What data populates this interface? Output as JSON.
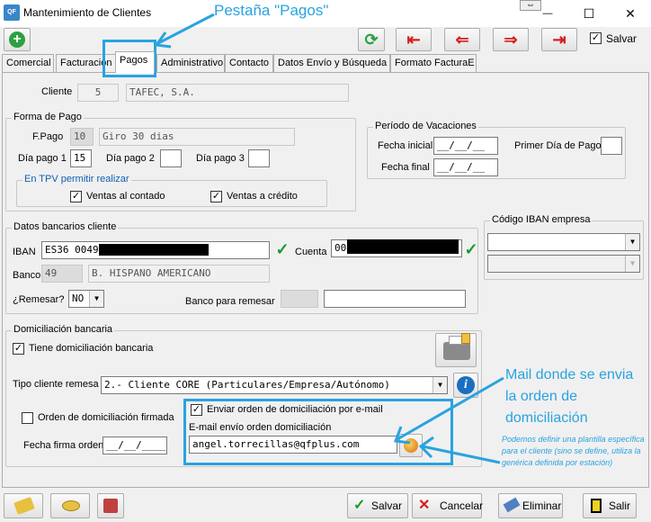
{
  "window": {
    "title": "Mantenimiento de Clientes",
    "app_icon_text": "QF",
    "restore_glyph": "⇔",
    "minimize_glyph": "—",
    "maximize_glyph": "☐",
    "close_glyph": "✕"
  },
  "toolbar": {
    "add_glyph": "+",
    "refresh_glyph": "⟳",
    "first_glyph": "⇤",
    "prev_glyph": "⇐",
    "next_glyph": "⇒",
    "last_glyph": "⇥",
    "save_label": "Salvar",
    "save_checked": "✓"
  },
  "tabs": [
    "Comercial",
    "Facturación",
    "Pagos",
    "Administrativo",
    "Contacto",
    "Datos Envío y Búsqueda",
    "Formato FacturaE"
  ],
  "annotations": {
    "tab_callout": "Pestaña \"Pagos\"",
    "mail_callout_1": "Mail donde se envia",
    "mail_callout_2": "la orden de",
    "mail_callout_3": "domiciliación",
    "plantilla_note": "Podemos definir una plantilla específica para el cliente (sino se define, utiliza la genérica definida por estación)"
  },
  "cliente": {
    "label": "Cliente",
    "code": "5",
    "name": "TAFEC, S.A."
  },
  "forma_pago": {
    "title": "Forma de Pago",
    "fpago_label": "F.Pago",
    "fpago_code": "10",
    "fpago_desc": "Giro 30 dias",
    "dia1_label": "Día pago 1",
    "dia1_value": "15",
    "dia2_label": "Día pago 2",
    "dia2_value": "",
    "dia3_label": "Día pago 3",
    "dia3_value": "",
    "tpv_title": "En TPV permitir realizar",
    "contado_label": "Ventas al contado",
    "credito_label": "Ventas a crédito"
  },
  "vacaciones": {
    "title": "Período de Vacaciones",
    "inicial_label": "Fecha inicial",
    "inicial_value": "__/__/__",
    "final_label": "Fecha final",
    "final_value": "__/__/__",
    "primer_dia_label": "Primer Día de Pago",
    "primer_dia_value": ""
  },
  "bancarios": {
    "title": "Datos bancarios cliente",
    "iban_label": "IBAN",
    "iban_value": "ES36 0049",
    "cuenta_label": "Cuenta",
    "cuenta_value": "004",
    "banco_label": "Banco",
    "banco_code": "49",
    "banco_name": "B. HISPANO AMERICANO",
    "remesar_label": "¿Remesar?",
    "remesar_value": "NO",
    "banco_remesar_label": "Banco para remesar"
  },
  "iban_empresa": {
    "title": "Código IBAN empresa"
  },
  "domiciliacion": {
    "title": "Domiciliación bancaria",
    "tiene_label": "Tiene domiciliación bancaria",
    "tipo_label": "Tipo cliente remesa",
    "tipo_value": "2.-  Cliente CORE (Particulares/Empresa/Autónomo)",
    "firmada_label": "Orden de domiciliación firmada",
    "fecha_firma_label": "Fecha firma orden",
    "fecha_firma_value": "__/__/____",
    "enviar_label": "Enviar orden de domiciliación por e-mail",
    "email_label": "E-mail envío orden domiciliación",
    "email_value": "angel.torrecillas@qfplus.com"
  },
  "bottom": {
    "salvar": "Salvar",
    "cancelar": "Cancelar",
    "eliminar": "Eliminar",
    "salir": "Salir"
  }
}
